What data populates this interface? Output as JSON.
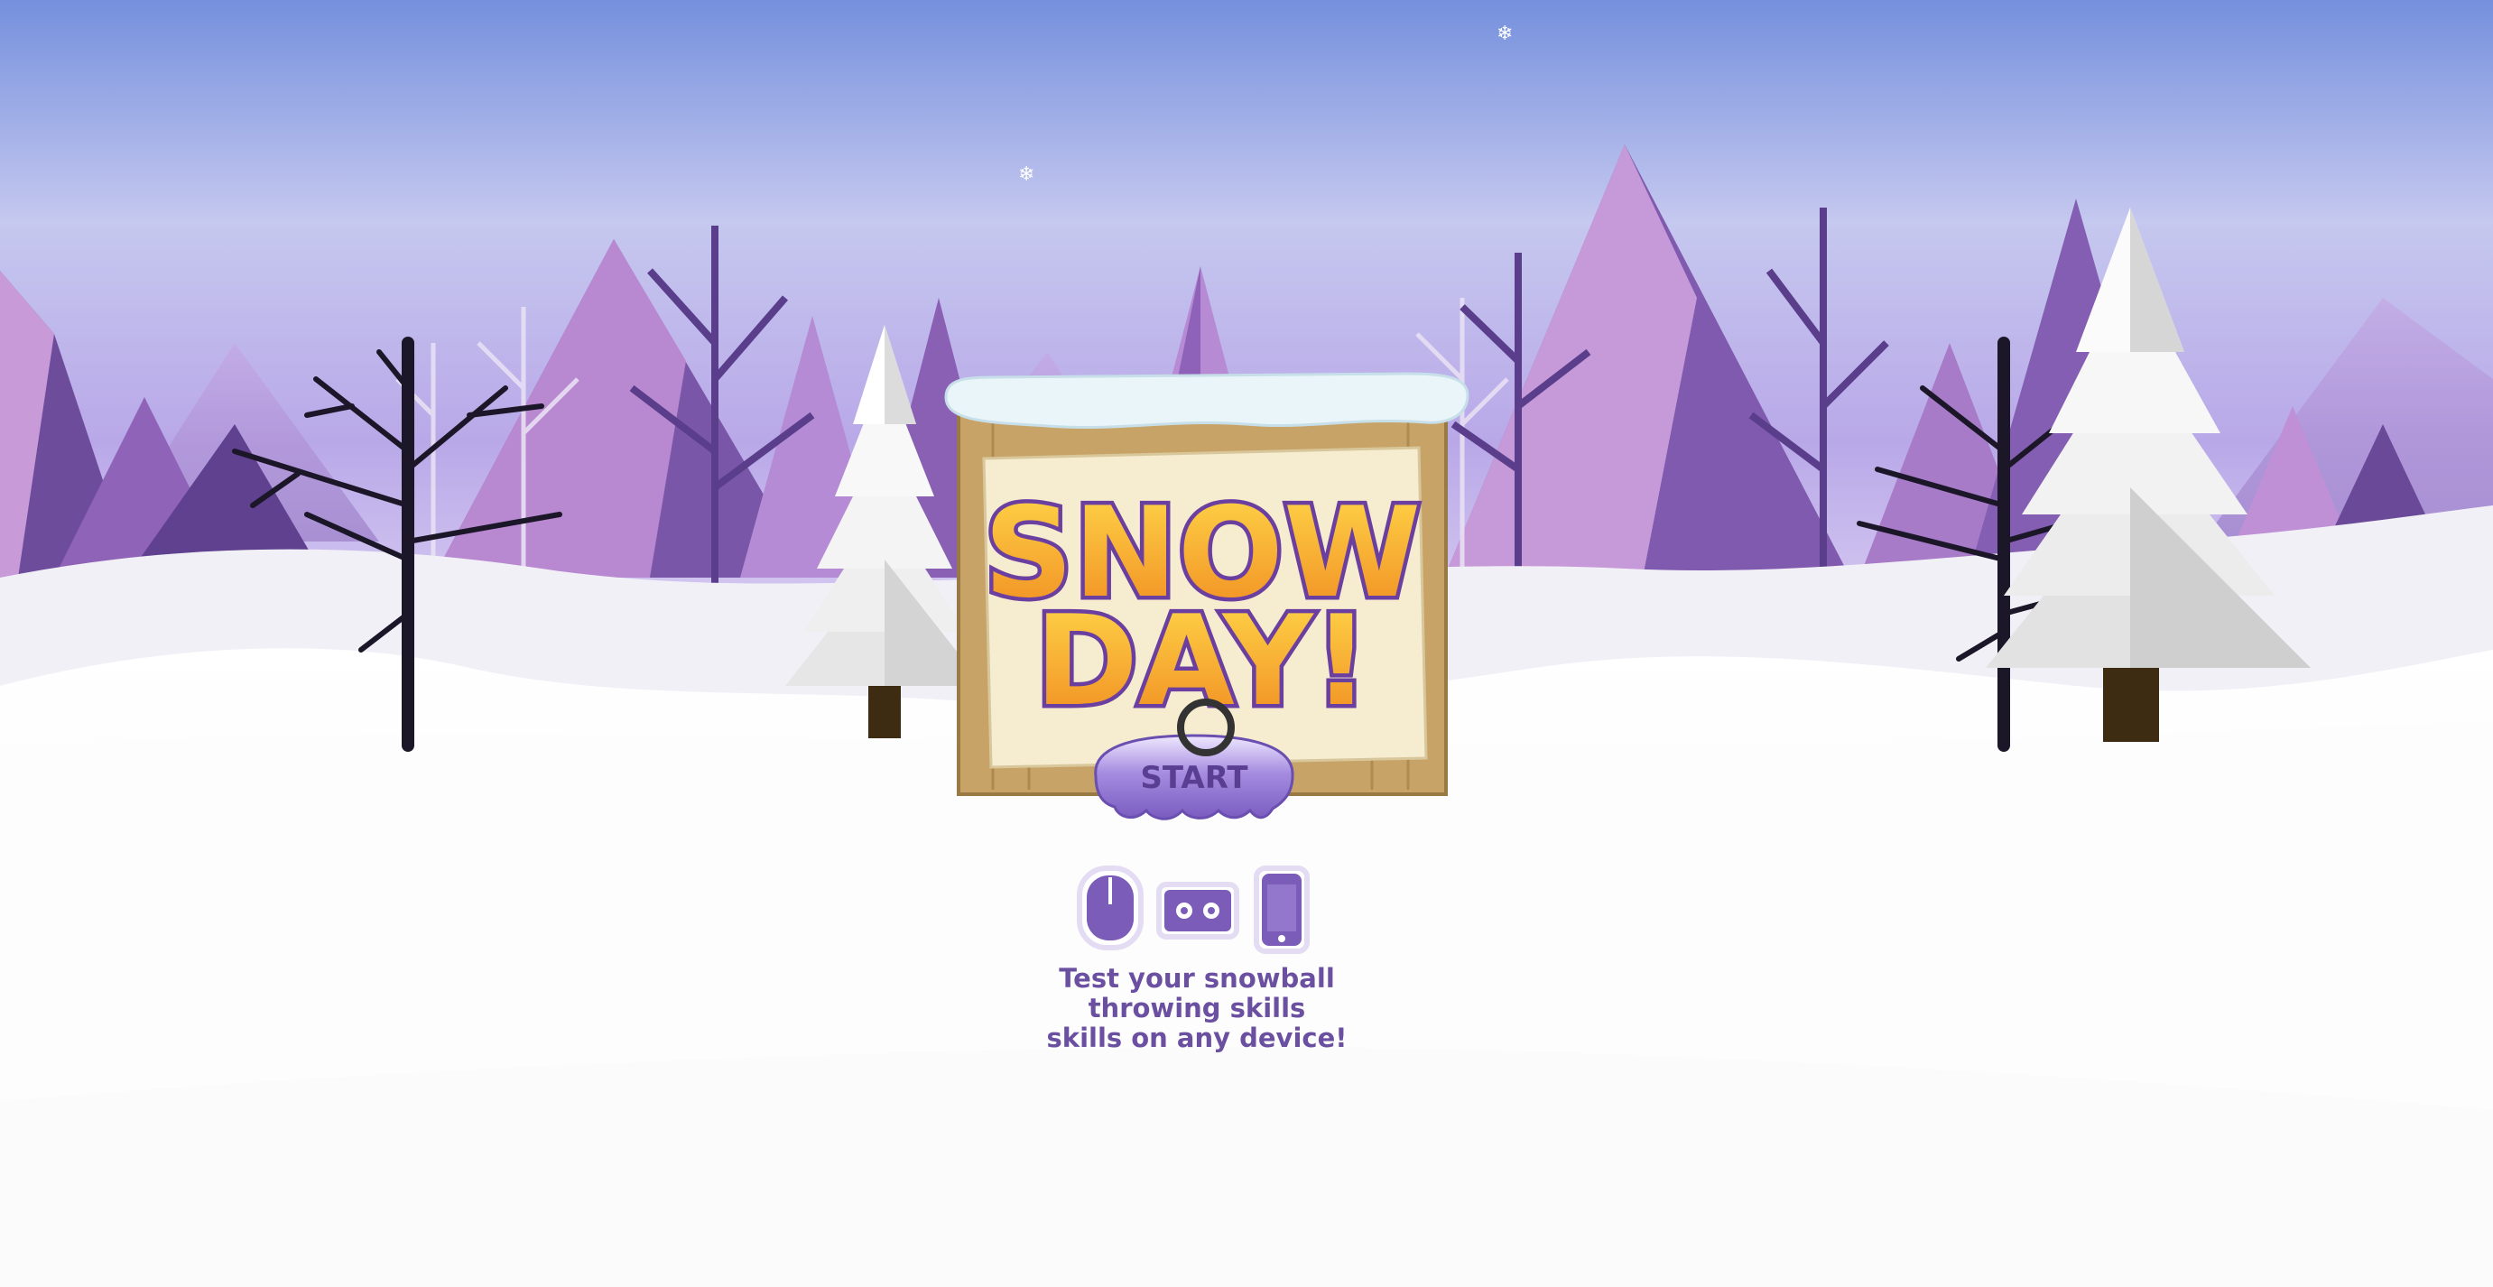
{
  "game": {
    "logo_line1": "SNOW",
    "logo_line2": "DAY!",
    "start_label": "START",
    "tagline_lines": [
      "Test your snowball",
      "throwing skills",
      "skills on any device!"
    ]
  },
  "devices": [
    "mouse-icon",
    "vr-headset-icon",
    "phone-icon"
  ],
  "colors": {
    "sky_top": "#7a92e0",
    "sky_bottom": "#c9b8ee",
    "mountain": "#7d5aa8",
    "logo_fill": "#f6a030",
    "logo_outline": "#6b3fa0",
    "button": "#8a6ccc",
    "text": "#6b4fa0",
    "sign_wood": "#c9a56b",
    "sign_paper": "#f6ecd0"
  }
}
